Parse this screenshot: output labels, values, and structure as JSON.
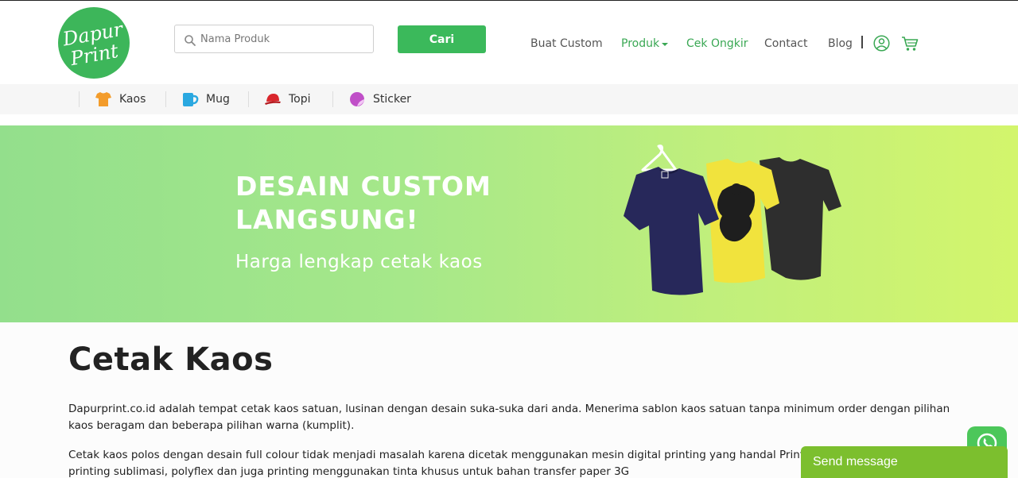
{
  "header": {
    "logo_text_line1": "Dapur",
    "logo_text_line2": "Print",
    "search": {
      "placeholder": "Nama Produk",
      "icon": "search-icon"
    },
    "search_button_label": "Cari",
    "nav": [
      {
        "label": "Buat Custom"
      },
      {
        "label": "Produk"
      },
      {
        "label": "Cek Ongkir"
      },
      {
        "label": "Contact"
      },
      {
        "label": "Blog"
      }
    ],
    "separator": "|",
    "icons": [
      "user-icon",
      "cart-icon"
    ]
  },
  "categories": [
    {
      "label": "Kaos",
      "icon": "tshirt-icon",
      "color": "#f39c2b"
    },
    {
      "label": "Mug",
      "icon": "mug-icon",
      "color": "#2aa8e0"
    },
    {
      "label": "Topi",
      "icon": "cap-icon",
      "color": "#d9262c"
    },
    {
      "label": "Sticker",
      "icon": "sticker-icon",
      "color": "#c04fc8"
    }
  ],
  "banner": {
    "headline_line1": "DESAIN CUSTOM",
    "headline_line2": "LANGSUNG!",
    "subtitle": "Harga lengkap cetak kaos"
  },
  "content": {
    "title": "Cetak Kaos",
    "paragraph1": "Dapurprint.co.id adalah tempat cetak kaos satuan, lusinan dengan desain suka-suka dari anda. Menerima sablon kaos satuan tanpa minimum order dengan pilihan kaos beragam dan beberapa pilihan warna (kumplit).",
    "paragraph2": "Cetak kaos polos dengan desain full colour tidak menjadi masalah karena dicetak menggunakan mesin digital printing yang handal Printer DTG, printing and cut, printing sublimasi, polyflex dan juga printing menggunakan tinta khusus untuk bahan transfer paper 3G"
  },
  "whatsapp": {
    "send_label": "Send message",
    "icon": "whatsapp-icon"
  },
  "colors": {
    "brand_green": "#3db65a",
    "nav_active": "#3aa854",
    "send_bar": "#7cbf2e"
  }
}
